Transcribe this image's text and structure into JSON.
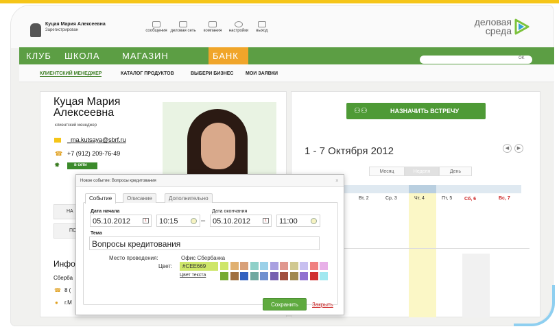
{
  "header": {
    "user_name": "Куцая Мария Алексеевна",
    "user_status": "Зарегистрирован",
    "nav": [
      {
        "label": "сообщения",
        "icon": "envelope-icon"
      },
      {
        "label": "деловая сеть",
        "icon": "network-icon"
      },
      {
        "label": "компания",
        "icon": "company-icon"
      },
      {
        "label": "настройки",
        "icon": "gear-icon"
      },
      {
        "label": "выход",
        "icon": "exit-icon"
      }
    ],
    "brand_line1": "деловая",
    "brand_line2": "среда"
  },
  "menu": {
    "items": [
      "КЛУБ",
      "ШКОЛА",
      "МАГАЗИН"
    ],
    "active": "БАНК",
    "search_button": "OK"
  },
  "subnav": {
    "items": [
      "КЛИЕНТСКИЙ МЕНЕДЖЕР",
      "КАТАЛОГ ПРОДУКТОВ",
      "ВЫБЕРИ БИЗНЕС",
      "МОИ ЗАЯВКИ"
    ]
  },
  "manager": {
    "name": "Куцая Мария Алексеевна",
    "role": "клиентский менеджер",
    "email": "_ma.kutsaya@sbrf.ru",
    "phone": "+7 (912) 209-76-49",
    "online": "в сети",
    "btn1": "НА",
    "btn2": "ПО"
  },
  "info": {
    "title": "Инфо",
    "line": "Сберба",
    "phone": "8 (",
    "address": "г.М"
  },
  "calendar": {
    "meet_button": "НАЗНАЧИТЬ ВСТРЕЧУ",
    "week_title": "1 - 7 Октября 2012",
    "views": [
      "Месяц",
      "Неделя",
      "День"
    ],
    "days": [
      {
        "label": "Вт, 2",
        "weekend": false
      },
      {
        "label": "Ср, 3",
        "weekend": false
      },
      {
        "label": "Чт, 4",
        "weekend": false
      },
      {
        "label": "Пт, 5",
        "weekend": false
      },
      {
        "label": "Сб, 6",
        "weekend": true
      },
      {
        "label": "Вс, 7",
        "weekend": true
      }
    ]
  },
  "dialog": {
    "title": "Новое событие: Вопросы кредитования",
    "tabs": [
      "Событие",
      "Описание",
      "Дополнительно"
    ],
    "start_label": "Дата начала",
    "start_date": "05.10.2012",
    "start_time": "10:15",
    "end_label": "Дата окончания",
    "end_date": "05.10.2012",
    "end_time": "11:00",
    "topic_label": "Тема",
    "topic": "Вопросы кредитования",
    "place_label": "Место проведения:",
    "place": "Офис Сбербанка",
    "color_label": "Цвет:",
    "color_value": "#CEE669",
    "text_color_label": "Цвет текста",
    "swatches_row1": [
      "#cee669",
      "#e0b070",
      "#d8a078",
      "#8fd0c8",
      "#9ad0e8",
      "#a9a0e0",
      "#e09890",
      "#d0c890",
      "#c8c0f0",
      "#f08080",
      "#e8b0e8"
    ],
    "swatches_row2": [
      "#77aa33",
      "#a07040",
      "#3060c0",
      "#70a8a0",
      "#7090d0",
      "#7760b0",
      "#a05040",
      "#a08850",
      "#9070d0",
      "#d03030",
      "#a0e8f0"
    ],
    "save": "Сохранить",
    "close": "Закрыть"
  }
}
